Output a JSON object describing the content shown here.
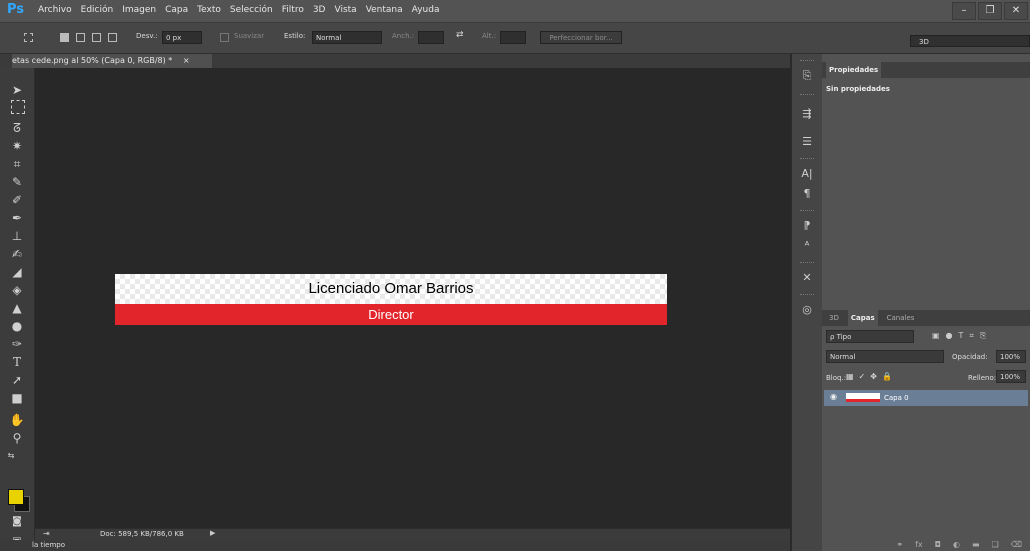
{
  "app": {
    "logo": "Ps"
  },
  "menu": [
    "Archivo",
    "Edición",
    "Imagen",
    "Capa",
    "Texto",
    "Selección",
    "Filtro",
    "3D",
    "Vista",
    "Ventana",
    "Ayuda"
  ],
  "window_buttons": {
    "minimize": "–",
    "restore": "❐",
    "close": "✕"
  },
  "options": {
    "feather_label": "Desv.:",
    "feather_value": "0 px",
    "antialias_label": "Suavizar",
    "style_label": "Estilo:",
    "style_value": "Normal",
    "width_label": "Anch.:",
    "height_label": "Alt.:",
    "refine_label": "Perfeccionar bor..."
  },
  "workspace": {
    "value": "3D"
  },
  "document": {
    "tab_title": "etas cede.png al 50% (Capa 0, RGB/8) *",
    "tab_close": "×",
    "status": "Doc: 589,5 KB/786,0 KB",
    "timeline_label": "la tiempo"
  },
  "artwork": {
    "name_text": "Licenciado Omar Barrios",
    "role_text": "Director",
    "band_color": "#e1252b"
  },
  "colors": {
    "foreground": "#e8d300",
    "background": "#111111"
  },
  "properties_panel": {
    "tab": "Propiedades",
    "body": "Sin propiedades"
  },
  "layers_panel": {
    "tabs": [
      "3D",
      "Capas",
      "Canales"
    ],
    "active_tab": "Capas",
    "filter_label": "ρ Tipo",
    "blend_mode": "Normal",
    "opacity_label": "Opacidad:",
    "opacity_value": "100%",
    "lock_label": "Bloq.:",
    "fill_label": "Relleno:",
    "fill_value": "100%",
    "layer_name": "Capa 0"
  }
}
